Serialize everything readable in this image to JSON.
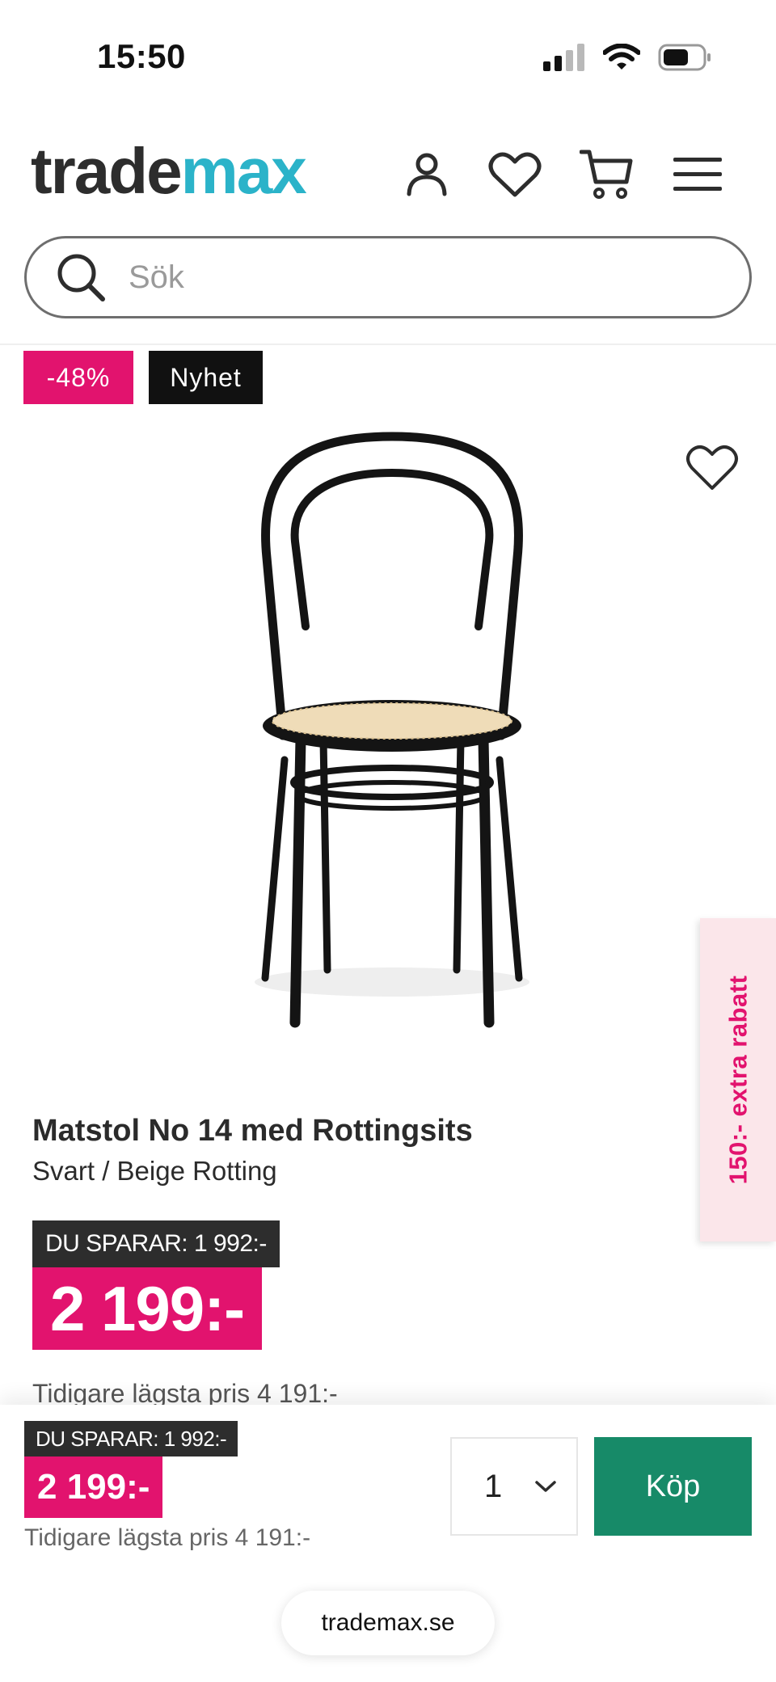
{
  "status_bar": {
    "time": "15:50"
  },
  "header": {
    "logo_part1": "trade",
    "logo_part2": "max",
    "icons": [
      "account-icon",
      "wishlist-icon",
      "cart-icon",
      "menu-icon"
    ],
    "search_placeholder": "Sök"
  },
  "badges": {
    "discount": "-48%",
    "new": "Nyhet"
  },
  "side_tab": {
    "label": "150:- extra rabatt"
  },
  "product": {
    "title": "Matstol No 14 med Rottingsits",
    "variant": "Svart / Beige Rotting",
    "save_label": "DU SPARAR: 1 992:-",
    "price": "2 199:-",
    "previous_lowest": "Tidigare lägsta pris 4 191:-"
  },
  "sticky": {
    "save_label": "DU SPARAR: 1 992:-",
    "price": "2 199:-",
    "previous_lowest": "Tidigare lägsta pris 4 191:-",
    "quantity": "1",
    "buy_label": "Köp"
  },
  "browser": {
    "url": "trademax.se"
  },
  "colors": {
    "accent_pink": "#e2136e",
    "logo_teal": "#2bb3c9",
    "buy_green": "#178a68",
    "dark": "#2d2d2d"
  }
}
